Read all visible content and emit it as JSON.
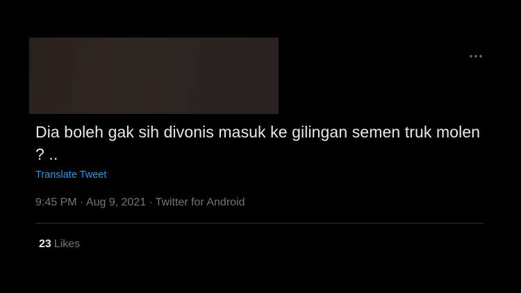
{
  "tweet": {
    "text": "Dia boleh gak sih divonis masuk ke gilingan semen truk molen ? ..",
    "translate_label": "Translate Tweet",
    "time": "9:45 PM",
    "date": "Aug 9, 2021",
    "source": "Twitter for Android",
    "separator": "·",
    "likes_count": "23",
    "likes_label": "Likes"
  },
  "icons": {
    "more": "more-horizontal-icon"
  },
  "colors": {
    "background": "#000000",
    "text": "#e7e9ea",
    "secondary_text": "#71767b",
    "link": "#1d9bf0",
    "divider": "#2f3336"
  }
}
